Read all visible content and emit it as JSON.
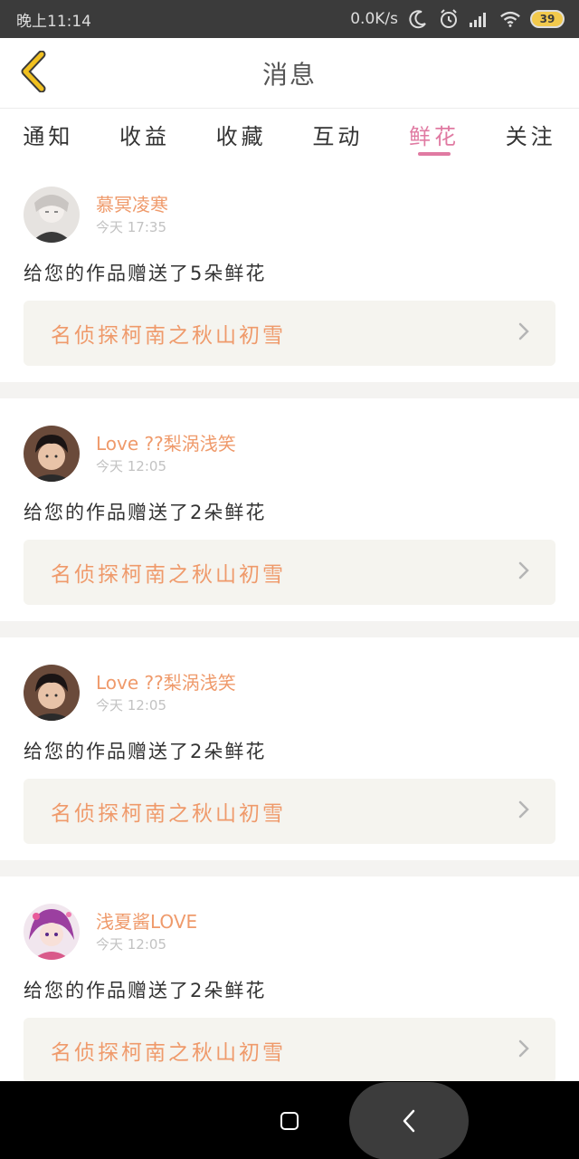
{
  "status_bar": {
    "time": "晚上11:14",
    "network_speed": "0.0K/s",
    "battery": "39",
    "icons": [
      "moon-icon",
      "alarm-icon",
      "signal-icon",
      "wifi-icon",
      "battery-icon"
    ]
  },
  "header": {
    "title": "消息",
    "back_icon": "chevron-left-icon"
  },
  "tabs": [
    {
      "label": "通知",
      "active": false
    },
    {
      "label": "收益",
      "active": false
    },
    {
      "label": "收藏",
      "active": false
    },
    {
      "label": "互动",
      "active": false
    },
    {
      "label": "鲜花",
      "active": true
    },
    {
      "label": "关注",
      "active": false
    }
  ],
  "messages": [
    {
      "username": "慕冥凌寒",
      "time": "今天 17:35",
      "text": "给您的作品赠送了5朵鲜花",
      "work_title": "名侦探柯南之秋山初雪",
      "avatar": "avatar-1"
    },
    {
      "username": "Love ??梨涡浅笑",
      "time": "今天 12:05",
      "text": "给您的作品赠送了2朵鲜花",
      "work_title": "名侦探柯南之秋山初雪",
      "avatar": "avatar-2"
    },
    {
      "username": "Love ??梨涡浅笑",
      "time": "今天 12:05",
      "text": "给您的作品赠送了2朵鲜花",
      "work_title": "名侦探柯南之秋山初雪",
      "avatar": "avatar-3"
    },
    {
      "username": "浅夏酱LOVE",
      "time": "今天 12:05",
      "text": "给您的作品赠送了2朵鲜花",
      "work_title": "名侦探柯南之秋山初雪",
      "avatar": "avatar-4"
    }
  ],
  "colors": {
    "accent_pink": "#e07aa2",
    "accent_orange": "#ef9a6b",
    "back_yellow": "#f0c020"
  },
  "nav_bar": {
    "icons": [
      "home-square-icon",
      "back-triangle-icon"
    ]
  }
}
